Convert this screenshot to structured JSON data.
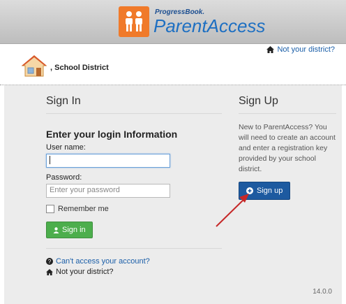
{
  "brand": {
    "small": "ProgressBook.",
    "big": "ParentAccess"
  },
  "header": {
    "not_district": "Not your district?",
    "district_name": ", School District"
  },
  "signin": {
    "title": "Sign In",
    "subtitle": "Enter your login Information",
    "username_label": "User name:",
    "username_value": "",
    "password_label": "Password:",
    "password_placeholder": "Enter your password",
    "remember_label": "Remember me",
    "button_label": "Sign in",
    "cant_access": "Can't access your account?",
    "not_district": "Not your district?"
  },
  "signup": {
    "title": "Sign Up",
    "text": "New to ParentAccess? You will need to create an account and enter a registration key provided by your school district.",
    "button_label": "Sign up"
  },
  "footer": {
    "version": "14.0.0"
  },
  "colors": {
    "orange": "#f07a2a",
    "blue_button": "#1d5aa0",
    "green_button": "#4cae4c",
    "annotation_arrow": "#c62828"
  }
}
